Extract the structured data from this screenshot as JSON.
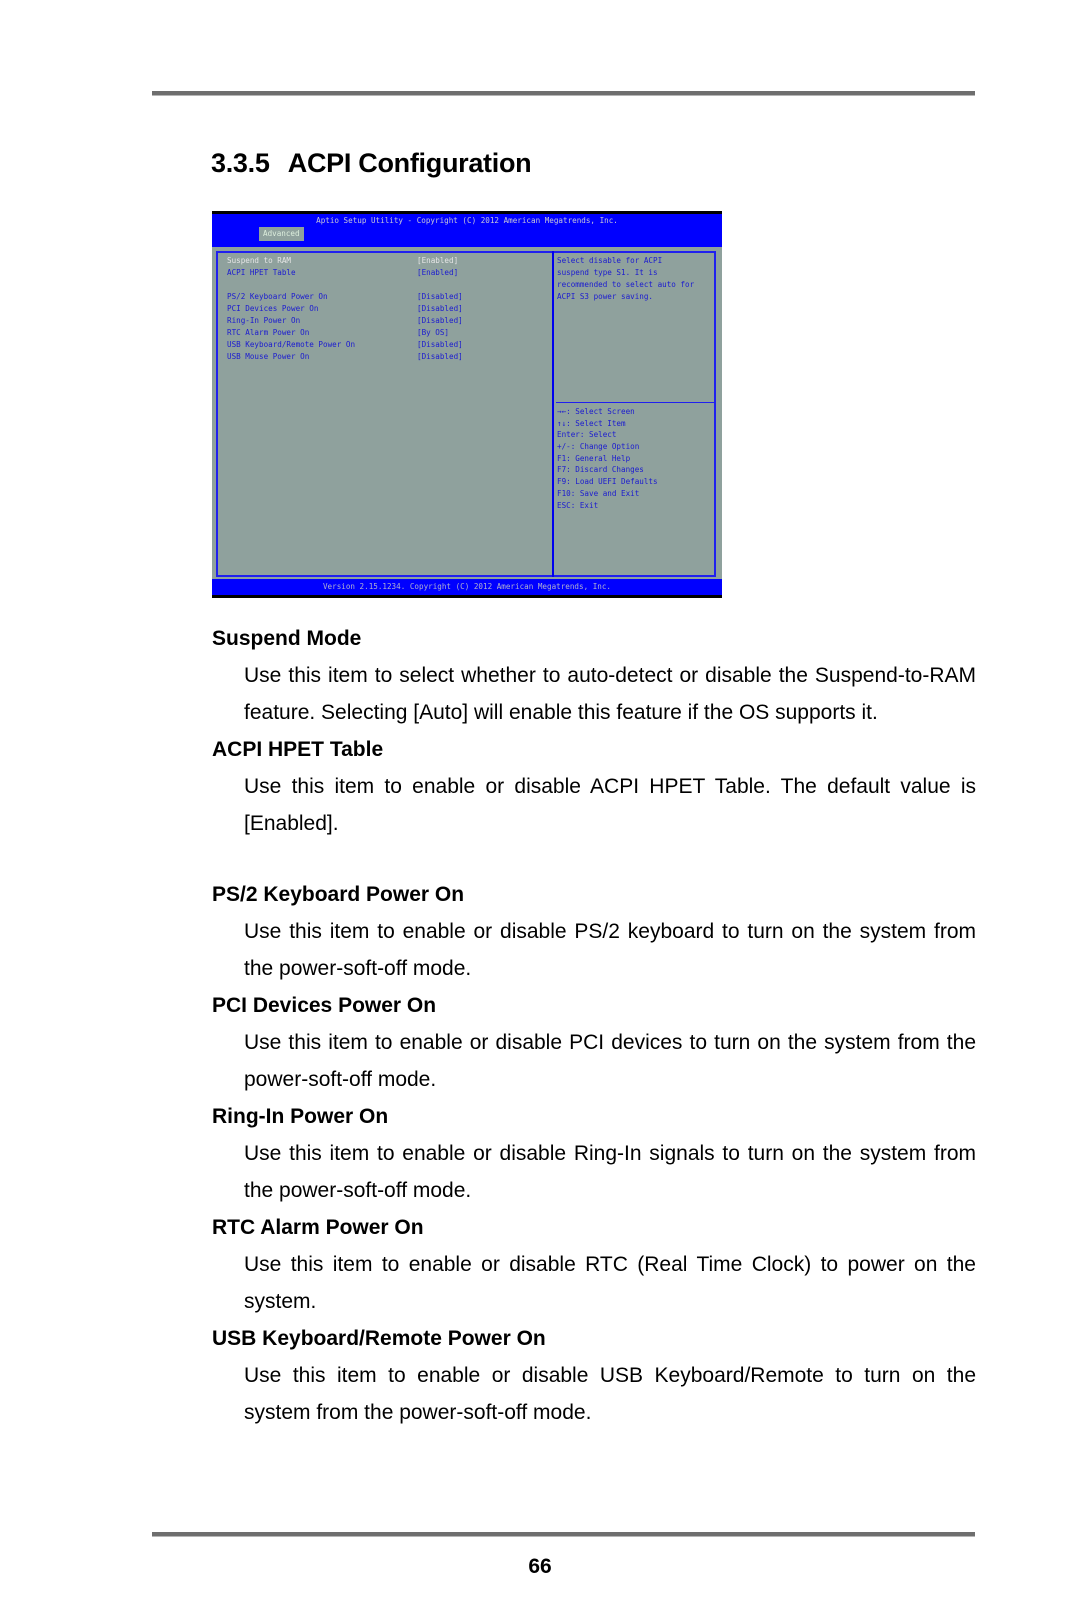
{
  "section": {
    "number": "3.3.5",
    "title": "ACPI Configuration"
  },
  "bios": {
    "header": "Aptio Setup Utility - Copyright (C) 2012 American Megatrends, Inc.",
    "active_tab": "Advanced",
    "items": [
      {
        "label": "Suspend to RAM",
        "value": "[Enabled]",
        "selected": true
      },
      {
        "label": "ACPI HPET Table",
        "value": "[Enabled]"
      },
      {
        "label": "PS/2 Keyboard Power On",
        "value": "[Disabled]"
      },
      {
        "label": "PCI Devices Power On",
        "value": "[Disabled]"
      },
      {
        "label": "Ring-In Power On",
        "value": "[Disabled]"
      },
      {
        "label": "RTC Alarm Power On",
        "value": "[By OS]"
      },
      {
        "label": "USB Keyboard/Remote Power On",
        "value": "[Disabled]"
      },
      {
        "label": "USB Mouse Power On",
        "value": "[Disabled]"
      }
    ],
    "help_text": [
      "Select disable for ACPI",
      "suspend type S1. It is",
      "recommended to select auto for",
      "ACPI S3 power saving."
    ],
    "key_help": [
      "→←: Select Screen",
      "↑↓: Select Item",
      "Enter: Select",
      "+/-: Change Option",
      "F1: General Help",
      "F7: Discard Changes",
      "F9: Load UEFI Defaults",
      "F10: Save and Exit",
      "ESC: Exit"
    ],
    "footer": "Version 2.15.1234. Copyright (C) 2012 American Megatrends, Inc.",
    "colors": {
      "blue": "#0000ff",
      "panel": "#8fa19d",
      "text": "#1b1bd0"
    }
  },
  "descriptions": [
    {
      "heading": "Suspend Mode",
      "text": "Use this item to select whether to auto-detect or disable the Suspend-to-RAM feature. Selecting [Auto] will enable this feature if the OS supports it."
    },
    {
      "heading": "ACPI HPET Table",
      "text": "Use this item to enable or disable ACPI HPET Table. The default value is [Enabled]."
    },
    {
      "heading": "PS/2 Keyboard Power On",
      "text": "Use this item to enable or disable PS/2 keyboard to turn on the system from the power-soft-off mode."
    },
    {
      "heading": "PCI Devices Power On",
      "text": "Use this item to enable or disable PCI devices to turn on the system from the power-soft-off mode."
    },
    {
      "heading": "Ring-In Power On",
      "text": "Use this item to enable or disable Ring-In signals to turn on the system from the power-soft-off mode."
    },
    {
      "heading": "RTC Alarm Power On",
      "text": "Use this item to enable or disable RTC (Real Time Clock) to power on the system."
    },
    {
      "heading": "USB Keyboard/Remote Power On",
      "text": "Use this item to enable or disable USB Keyboard/Remote to turn on the system from the power-soft-off mode."
    }
  ],
  "page_number": "66"
}
